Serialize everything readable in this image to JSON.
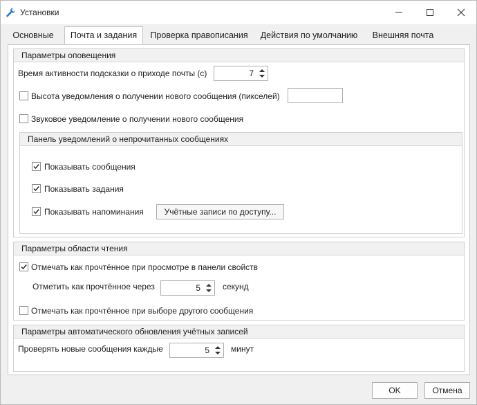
{
  "window": {
    "title": "Установки",
    "icon": "wrench-icon"
  },
  "tabs": [
    {
      "label": "Основные",
      "active": false
    },
    {
      "label": "Почта и задания",
      "active": true
    },
    {
      "label": "Проверка правописания",
      "active": false
    },
    {
      "label": "Действия по умолчанию",
      "active": false
    },
    {
      "label": "Внешняя почта",
      "active": false
    }
  ],
  "notifications": {
    "header": "Параметры оповещения",
    "tip_time_label": "Время активности подсказки о приходе почты (с)",
    "tip_time_value": "7",
    "height": {
      "label": "Высота уведомления о получении нового сообщения (пикселей)",
      "checked": false,
      "value": ""
    },
    "sound": {
      "label": "Звуковое уведомление о получении нового сообщения",
      "checked": false
    },
    "unread_panel": {
      "header": "Панель уведомлений о непрочитанных сообщениях",
      "show_messages": {
        "label": "Показывать сообщения",
        "checked": true
      },
      "show_tasks": {
        "label": "Показывать задания",
        "checked": true
      },
      "show_reminders": {
        "label": "Показывать напоминания",
        "checked": true
      },
      "accounts_button": "Учётные записи по доступу..."
    }
  },
  "reading_pane": {
    "header": "Параметры области чтения",
    "mark_read_preview": {
      "label": "Отмечать как прочтённое при просмотре в панели свойств",
      "checked": true
    },
    "mark_after_label": "Отметить как прочтённое через",
    "mark_after_value": "5",
    "mark_after_unit": "секунд",
    "mark_read_select": {
      "label": "Отмечать как прочтённое при выборе другого сообщения",
      "checked": false
    }
  },
  "auto_refresh": {
    "header": "Параметры автоматического обновления учётных записей",
    "check_label": "Проверять новые сообщения каждые",
    "check_value": "5",
    "check_unit": "минут"
  },
  "buttons": {
    "ok": "OK",
    "cancel": "Отмена"
  }
}
